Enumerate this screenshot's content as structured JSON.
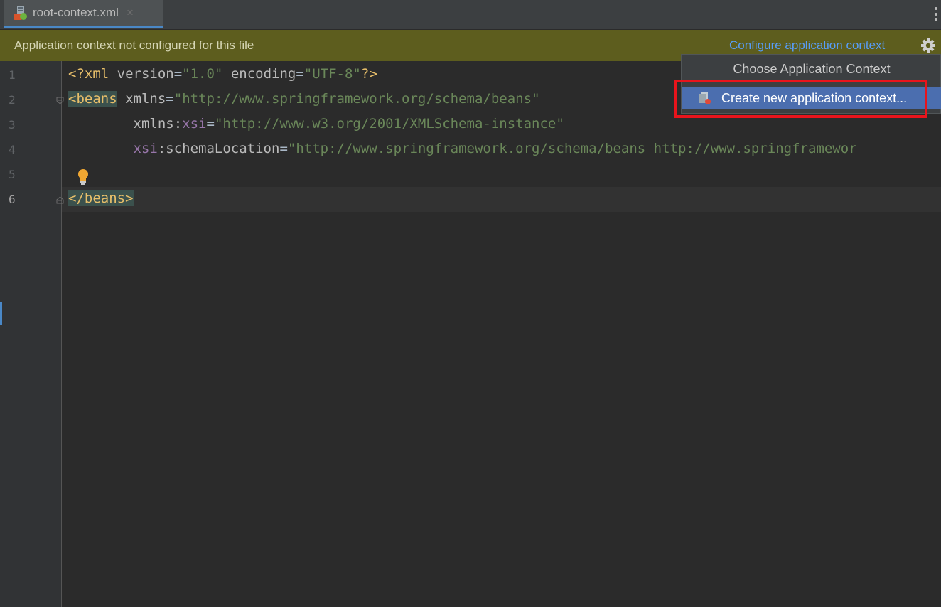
{
  "tab": {
    "label": "root-context.xml",
    "close": "×"
  },
  "notification": {
    "message": "Application context not configured for this file",
    "link": "Configure application context"
  },
  "gutter": {
    "line_numbers": [
      "1",
      "2",
      "3",
      "4",
      "5",
      "6"
    ]
  },
  "code": {
    "line1": {
      "pi_open": "<?xml ",
      "attr1": "version",
      "eq1": "=",
      "val1": "\"1.0\"",
      "sp": " ",
      "attr2": "encoding",
      "eq2": "=",
      "val2": "\"UTF-8\"",
      "pi_close": "?>"
    },
    "line2": {
      "tag": "<beans",
      "sp": " ",
      "attr": "xmlns",
      "eq": "=",
      "val": "\"http://www.springframework.org/schema/beans\""
    },
    "line3": {
      "indent": "        ",
      "attr": "xmlns:",
      "ns": "xsi",
      "eq": "=",
      "val": "\"http://www.w3.org/2001/XMLSchema-instance\""
    },
    "line4": {
      "indent": "        ",
      "ns": "xsi",
      "attr": ":schemaLocation",
      "eq": "=",
      "val": "\"http://www.springframework.org/schema/beans http://www.springframewor"
    },
    "line6": {
      "tag": "</beans",
      "close": ">"
    }
  },
  "popup": {
    "title": "Choose Application Context",
    "item": "Create new application context..."
  },
  "colors": {
    "accent": "#4b6eaf",
    "highlight_box": "#e8141c",
    "notice_bg": "#5d5d1e"
  }
}
